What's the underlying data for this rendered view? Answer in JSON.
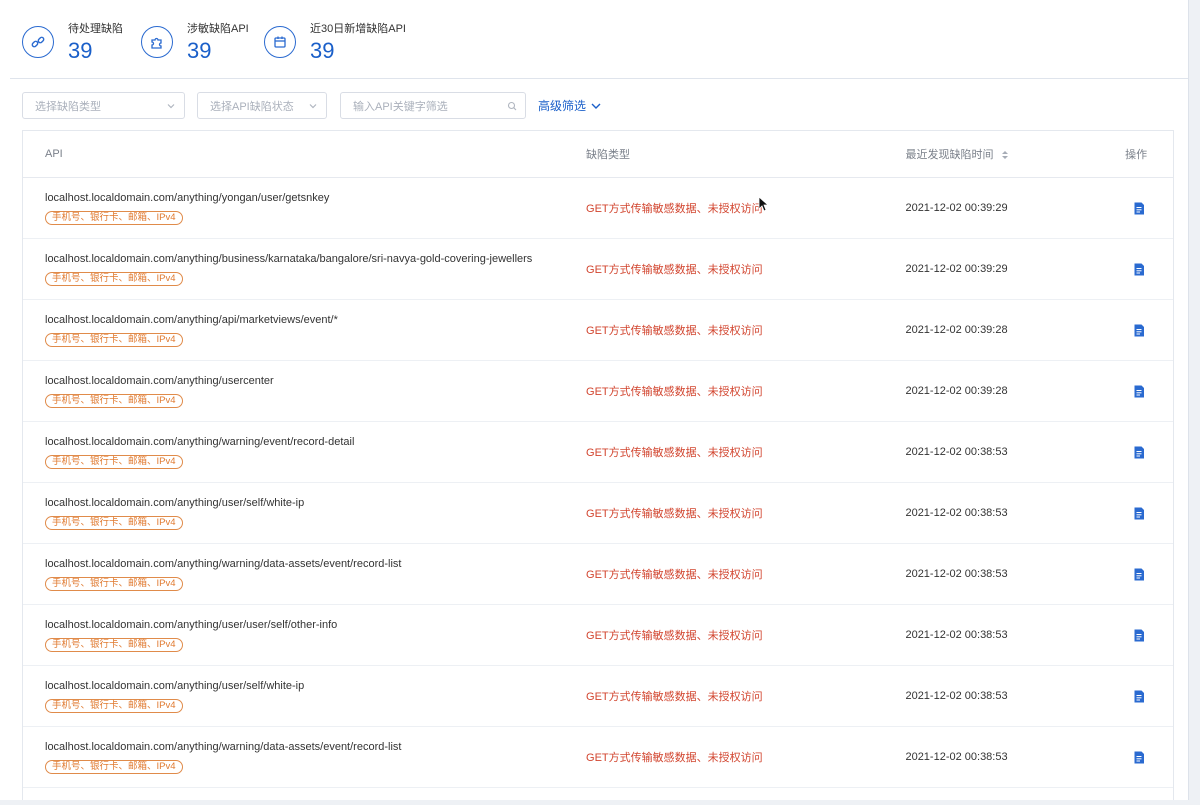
{
  "stats": [
    {
      "label": "待处理缺陷",
      "value": "39",
      "icon": "link-icon"
    },
    {
      "label": "涉敏缺陷API",
      "value": "39",
      "icon": "puzzle-icon"
    },
    {
      "label": "近30日新增缺陷API",
      "value": "39",
      "icon": "calendar-icon"
    }
  ],
  "filters": {
    "type_placeholder": "选择缺陷类型",
    "status_placeholder": "选择API缺陷状态",
    "keyword_placeholder": "输入API关键字筛选",
    "advanced_label": "高级筛选"
  },
  "table": {
    "headers": {
      "api": "API",
      "type": "缺陷类型",
      "time": "最近发现缺陷时间",
      "op": "操作"
    },
    "rows": [
      {
        "url": "localhost.localdomain.com/anything/yongan/user/getsnkey",
        "tag": "手机号、银行卡、邮箱、IPv4",
        "type": "GET方式传输敏感数据、未授权访问",
        "time": "2021-12-02 00:39:29"
      },
      {
        "url": "localhost.localdomain.com/anything/business/karnataka/bangalore/sri-navya-gold-covering-jewellers",
        "tag": "手机号、银行卡、邮箱、IPv4",
        "type": "GET方式传输敏感数据、未授权访问",
        "time": "2021-12-02 00:39:29"
      },
      {
        "url": "localhost.localdomain.com/anything/api/marketviews/event/*",
        "tag": "手机号、银行卡、邮箱、IPv4",
        "type": "GET方式传输敏感数据、未授权访问",
        "time": "2021-12-02 00:39:28"
      },
      {
        "url": "localhost.localdomain.com/anything/usercenter",
        "tag": "手机号、银行卡、邮箱、IPv4",
        "type": "GET方式传输敏感数据、未授权访问",
        "time": "2021-12-02 00:39:28"
      },
      {
        "url": "localhost.localdomain.com/anything/warning/event/record-detail",
        "tag": "手机号、银行卡、邮箱、IPv4",
        "type": "GET方式传输敏感数据、未授权访问",
        "time": "2021-12-02 00:38:53"
      },
      {
        "url": "localhost.localdomain.com/anything/user/self/white-ip",
        "tag": "手机号、银行卡、邮箱、IPv4",
        "type": "GET方式传输敏感数据、未授权访问",
        "time": "2021-12-02 00:38:53"
      },
      {
        "url": "localhost.localdomain.com/anything/warning/data-assets/event/record-list",
        "tag": "手机号、银行卡、邮箱、IPv4",
        "type": "GET方式传输敏感数据、未授权访问",
        "time": "2021-12-02 00:38:53"
      },
      {
        "url": "localhost.localdomain.com/anything/user/user/self/other-info",
        "tag": "手机号、银行卡、邮箱、IPv4",
        "type": "GET方式传输敏感数据、未授权访问",
        "time": "2021-12-02 00:38:53"
      },
      {
        "url": "localhost.localdomain.com/anything/user/self/white-ip",
        "tag": "手机号、银行卡、邮箱、IPv4",
        "type": "GET方式传输敏感数据、未授权访问",
        "time": "2021-12-02 00:38:53"
      },
      {
        "url": "localhost.localdomain.com/anything/warning/data-assets/event/record-list",
        "tag": "手机号、银行卡、邮箱、IPv4",
        "type": "GET方式传输敏感数据、未授权访问",
        "time": "2021-12-02 00:38:53"
      }
    ]
  },
  "colors": {
    "accent": "#1a5fc9",
    "danger": "#d2452f",
    "tag": "#e07a30"
  }
}
